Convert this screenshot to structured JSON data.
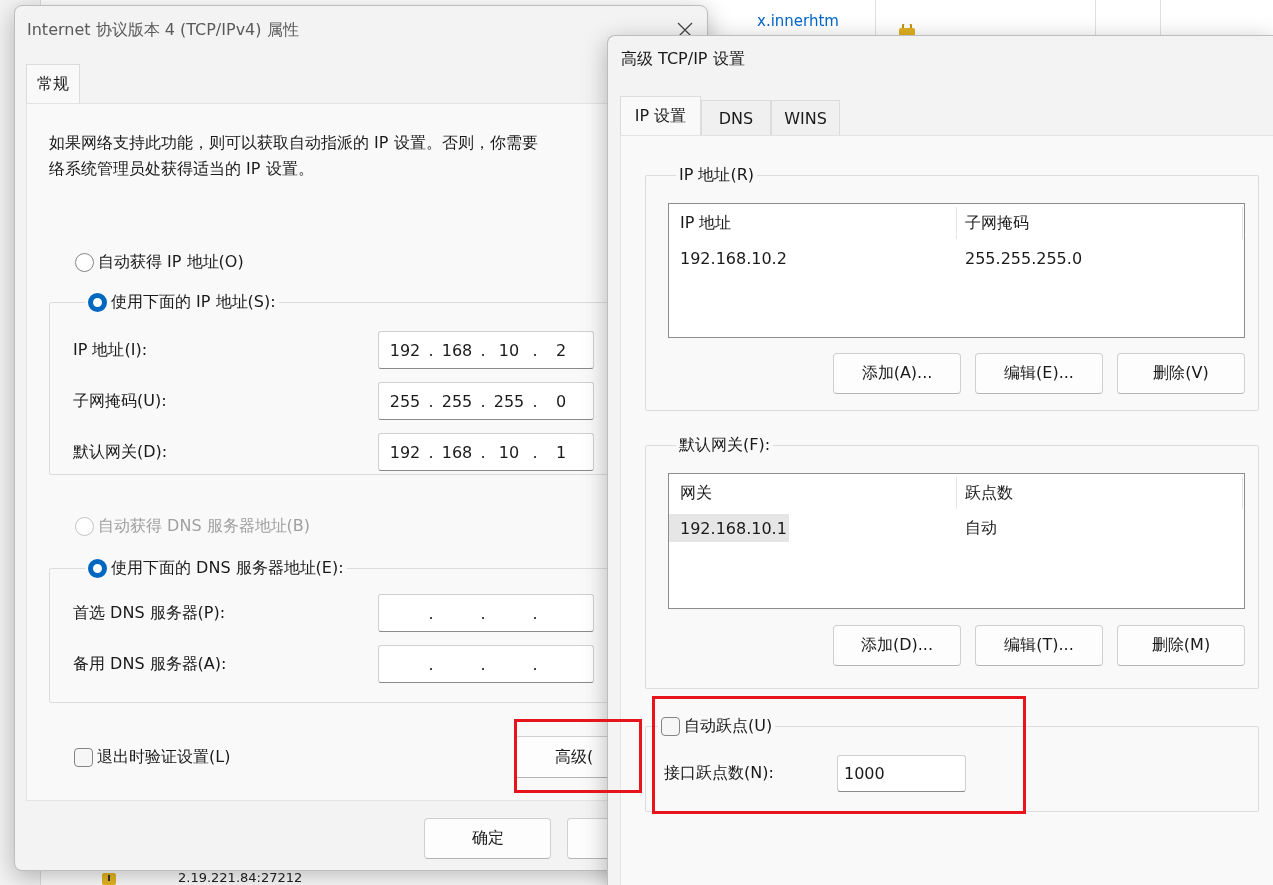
{
  "background": {
    "link": "x.innerhtm",
    "address": "2.19.221.84:27212"
  },
  "ipv4_dialog": {
    "title": "Internet 协议版本 4 (TCP/IPv4) 属性",
    "tabs": [
      {
        "label": "常规",
        "selected": true
      }
    ],
    "description": [
      "如果网络支持此功能，则可以获取自动指派的 IP 设置。否则，你需要",
      "络系统管理员处获得适当的 IP 设置。"
    ],
    "ip_mode": [
      {
        "label": "自动获得 IP 地址(O)",
        "selected": false,
        "disabled": false
      },
      {
        "label": "使用下面的 IP 地址(S):",
        "selected": true,
        "disabled": false
      }
    ],
    "ip_fields": [
      {
        "label": "IP 地址(I):",
        "octets": [
          "192",
          "168",
          "10",
          "2"
        ],
        "separators": [
          ".",
          ".",
          "."
        ]
      },
      {
        "label": "子网掩码(U):",
        "octets": [
          "255",
          "255",
          "255",
          "0"
        ],
        "separators": [
          ".",
          ".",
          "."
        ]
      },
      {
        "label": "默认网关(D):",
        "octets": [
          "192",
          "168",
          "10",
          "1"
        ],
        "separators": [
          ".",
          ".",
          "."
        ]
      }
    ],
    "dns_mode": [
      {
        "label": "自动获得 DNS 服务器地址(B)",
        "selected": false,
        "disabled": true
      },
      {
        "label": "使用下面的 DNS 服务器地址(E):",
        "selected": true,
        "disabled": false
      }
    ],
    "dns_fields": [
      {
        "label": "首选 DNS 服务器(P):",
        "separators": [
          ".",
          ".",
          "."
        ]
      },
      {
        "label": "备用 DNS 服务器(A):",
        "separators": [
          ".",
          ".",
          "."
        ]
      }
    ],
    "validate_on_exit": {
      "label": "退出时验证设置(L)",
      "checked": false
    },
    "advanced_button": "高级(",
    "buttons": [
      "确定"
    ]
  },
  "advanced_dialog": {
    "title": "高级 TCP/IP 设置",
    "tabs": [
      {
        "label": "IP 设置",
        "selected": true
      },
      {
        "label": "DNS",
        "selected": false
      },
      {
        "label": "WINS",
        "selected": false
      }
    ],
    "ip_group": {
      "title": "IP 地址(R)",
      "columns": [
        "IP 地址",
        "子网掩码"
      ],
      "rows": [
        {
          "cells": [
            "192.168.10.2",
            "255.255.255.0"
          ],
          "selected": false
        }
      ],
      "buttons": [
        "添加(A)...",
        "编辑(E)...",
        "删除(V)"
      ]
    },
    "gateway_group": {
      "title": "默认网关(F):",
      "columns": [
        "网关",
        "跃点数"
      ],
      "rows": [
        {
          "cells": [
            "192.168.10.1",
            "自动"
          ],
          "selected": true
        }
      ],
      "buttons": [
        "添加(D)...",
        "编辑(T)...",
        "删除(M)"
      ]
    },
    "automatic_metric": {
      "label": "自动跃点(U)",
      "checked": false
    },
    "interface_metric": {
      "label": "接口跃点数(N):",
      "value": "1000"
    }
  }
}
